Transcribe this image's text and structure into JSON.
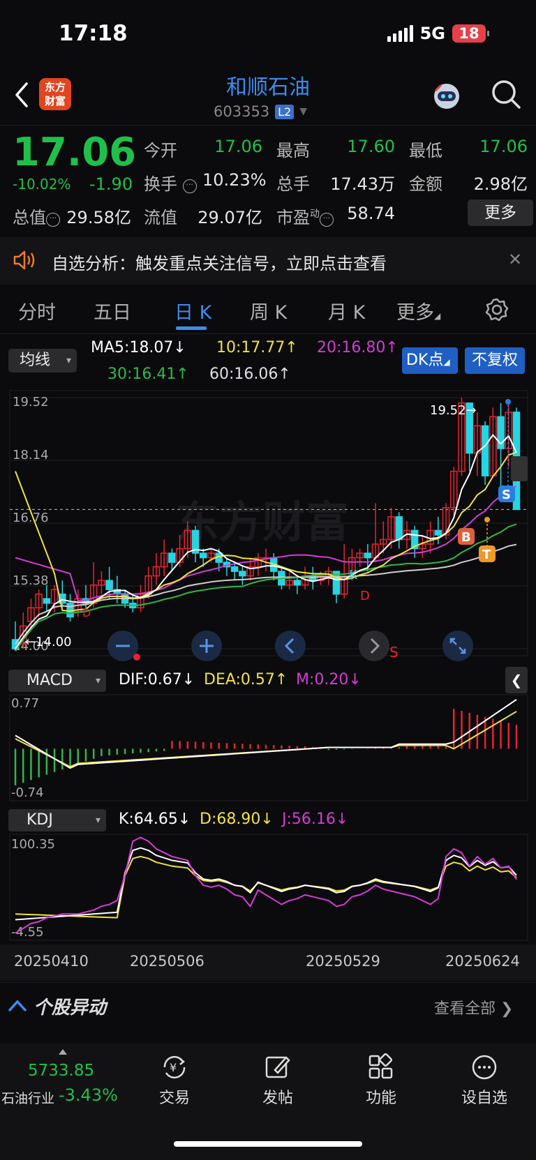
{
  "status": {
    "time": "17:18",
    "network": "5G",
    "battery": "18"
  },
  "header": {
    "logo_line1": "东方",
    "logo_line2": "财富",
    "stock_name": "和顺石油",
    "stock_code": "603353",
    "level_badge": "L2"
  },
  "quote": {
    "price": "17.06",
    "change_pct": "-10.02%",
    "change_amt": "-1.90",
    "open_label": "今开",
    "open": "17.06",
    "high_label": "最高",
    "high": "17.60",
    "low_label": "最低",
    "low": "17.06",
    "turnover_label": "换手",
    "turnover": "10.23%",
    "volume_label": "总手",
    "volume": "17.43万",
    "amount_label": "金额",
    "amount": "2.98亿",
    "mktcap_label": "总值",
    "mktcap": "29.58亿",
    "float_label": "流值",
    "float": "29.07亿",
    "pe_label": "市盈",
    "pe_sup": "动",
    "pe": "58.74",
    "more_button": "更多"
  },
  "notice": {
    "text": "自选分析：触发重点关注信号，立即点击查看"
  },
  "tabs": [
    {
      "label": "分时"
    },
    {
      "label": "五日"
    },
    {
      "label": "日 K"
    },
    {
      "label": "周 K"
    },
    {
      "label": "月 K"
    },
    {
      "label": "更多"
    }
  ],
  "ma": {
    "selector": "均线",
    "ma5": "MA5:18.07↓",
    "ma10": "10:17.77↑",
    "ma20": "20:16.80↑",
    "ma30": "30:16.41↑",
    "ma60": "60:16.06↑",
    "dk_button": "DK点",
    "fq_button": "不复权",
    "colors": {
      "ma5": "#ffffff",
      "ma10": "#f2e23c",
      "ma20": "#d63ad6",
      "ma30": "#2fb84a",
      "ma60": "#cfcfcf"
    }
  },
  "kline": {
    "y_ticks": [
      "19.52",
      "18.14",
      "16.76",
      "15.38",
      "14.00"
    ],
    "max_label": "19.52→",
    "min_label": "←14.00",
    "marker_b": "B",
    "marker_t": "T",
    "marker_s": "S",
    "marker_s_red": "S",
    "marker_k": "K",
    "marker_d": "D",
    "marker_d_left": "D",
    "watermark": "东方财富",
    "up_color": "#e8232f",
    "down_color": "#27d4e2"
  },
  "macd": {
    "selector": "MACD",
    "dif": "DIF:0.67↓",
    "dea": "DEA:0.57↑",
    "m": "M:0.20↓",
    "y_top": "0.77",
    "y_bottom": "-0.74"
  },
  "kdj": {
    "selector": "KDJ",
    "k": "K:64.65↓",
    "d": "D:68.90↓",
    "j": "J:56.16↓",
    "y_top": "100.35",
    "y_bottom": "-4.55"
  },
  "dates": [
    "20250410",
    "20250506",
    "20250529",
    "20250624"
  ],
  "yidong": {
    "title": "个股异动",
    "view_all": "查看全部"
  },
  "bottom_nav": {
    "index_value": "5733.85",
    "industry_label": "石油行业",
    "industry_change": "-3.43%",
    "items": [
      {
        "label": "交易"
      },
      {
        "label": "发帖"
      },
      {
        "label": "功能"
      },
      {
        "label": "设自选"
      }
    ]
  }
}
